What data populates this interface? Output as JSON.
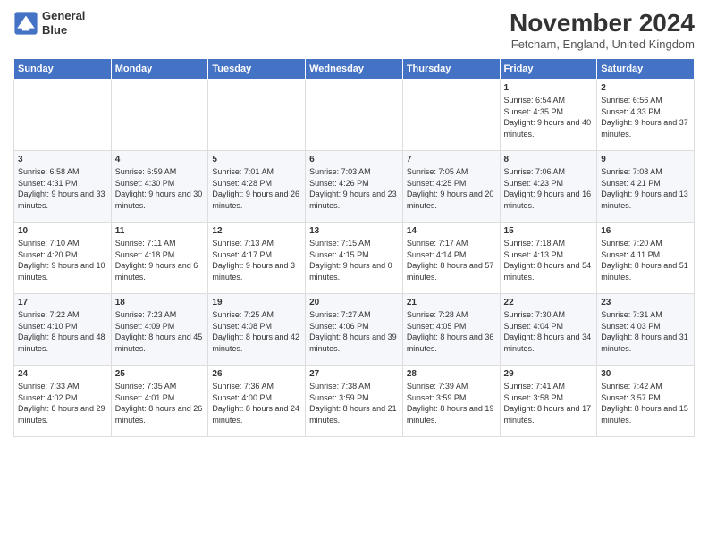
{
  "logo": {
    "line1": "General",
    "line2": "Blue"
  },
  "title": "November 2024",
  "subtitle": "Fetcham, England, United Kingdom",
  "days_of_week": [
    "Sunday",
    "Monday",
    "Tuesday",
    "Wednesday",
    "Thursday",
    "Friday",
    "Saturday"
  ],
  "weeks": [
    [
      {
        "day": "",
        "info": ""
      },
      {
        "day": "",
        "info": ""
      },
      {
        "day": "",
        "info": ""
      },
      {
        "day": "",
        "info": ""
      },
      {
        "day": "",
        "info": ""
      },
      {
        "day": "1",
        "info": "Sunrise: 6:54 AM\nSunset: 4:35 PM\nDaylight: 9 hours and 40 minutes."
      },
      {
        "day": "2",
        "info": "Sunrise: 6:56 AM\nSunset: 4:33 PM\nDaylight: 9 hours and 37 minutes."
      }
    ],
    [
      {
        "day": "3",
        "info": "Sunrise: 6:58 AM\nSunset: 4:31 PM\nDaylight: 9 hours and 33 minutes."
      },
      {
        "day": "4",
        "info": "Sunrise: 6:59 AM\nSunset: 4:30 PM\nDaylight: 9 hours and 30 minutes."
      },
      {
        "day": "5",
        "info": "Sunrise: 7:01 AM\nSunset: 4:28 PM\nDaylight: 9 hours and 26 minutes."
      },
      {
        "day": "6",
        "info": "Sunrise: 7:03 AM\nSunset: 4:26 PM\nDaylight: 9 hours and 23 minutes."
      },
      {
        "day": "7",
        "info": "Sunrise: 7:05 AM\nSunset: 4:25 PM\nDaylight: 9 hours and 20 minutes."
      },
      {
        "day": "8",
        "info": "Sunrise: 7:06 AM\nSunset: 4:23 PM\nDaylight: 9 hours and 16 minutes."
      },
      {
        "day": "9",
        "info": "Sunrise: 7:08 AM\nSunset: 4:21 PM\nDaylight: 9 hours and 13 minutes."
      }
    ],
    [
      {
        "day": "10",
        "info": "Sunrise: 7:10 AM\nSunset: 4:20 PM\nDaylight: 9 hours and 10 minutes."
      },
      {
        "day": "11",
        "info": "Sunrise: 7:11 AM\nSunset: 4:18 PM\nDaylight: 9 hours and 6 minutes."
      },
      {
        "day": "12",
        "info": "Sunrise: 7:13 AM\nSunset: 4:17 PM\nDaylight: 9 hours and 3 minutes."
      },
      {
        "day": "13",
        "info": "Sunrise: 7:15 AM\nSunset: 4:15 PM\nDaylight: 9 hours and 0 minutes."
      },
      {
        "day": "14",
        "info": "Sunrise: 7:17 AM\nSunset: 4:14 PM\nDaylight: 8 hours and 57 minutes."
      },
      {
        "day": "15",
        "info": "Sunrise: 7:18 AM\nSunset: 4:13 PM\nDaylight: 8 hours and 54 minutes."
      },
      {
        "day": "16",
        "info": "Sunrise: 7:20 AM\nSunset: 4:11 PM\nDaylight: 8 hours and 51 minutes."
      }
    ],
    [
      {
        "day": "17",
        "info": "Sunrise: 7:22 AM\nSunset: 4:10 PM\nDaylight: 8 hours and 48 minutes."
      },
      {
        "day": "18",
        "info": "Sunrise: 7:23 AM\nSunset: 4:09 PM\nDaylight: 8 hours and 45 minutes."
      },
      {
        "day": "19",
        "info": "Sunrise: 7:25 AM\nSunset: 4:08 PM\nDaylight: 8 hours and 42 minutes."
      },
      {
        "day": "20",
        "info": "Sunrise: 7:27 AM\nSunset: 4:06 PM\nDaylight: 8 hours and 39 minutes."
      },
      {
        "day": "21",
        "info": "Sunrise: 7:28 AM\nSunset: 4:05 PM\nDaylight: 8 hours and 36 minutes."
      },
      {
        "day": "22",
        "info": "Sunrise: 7:30 AM\nSunset: 4:04 PM\nDaylight: 8 hours and 34 minutes."
      },
      {
        "day": "23",
        "info": "Sunrise: 7:31 AM\nSunset: 4:03 PM\nDaylight: 8 hours and 31 minutes."
      }
    ],
    [
      {
        "day": "24",
        "info": "Sunrise: 7:33 AM\nSunset: 4:02 PM\nDaylight: 8 hours and 29 minutes."
      },
      {
        "day": "25",
        "info": "Sunrise: 7:35 AM\nSunset: 4:01 PM\nDaylight: 8 hours and 26 minutes."
      },
      {
        "day": "26",
        "info": "Sunrise: 7:36 AM\nSunset: 4:00 PM\nDaylight: 8 hours and 24 minutes."
      },
      {
        "day": "27",
        "info": "Sunrise: 7:38 AM\nSunset: 3:59 PM\nDaylight: 8 hours and 21 minutes."
      },
      {
        "day": "28",
        "info": "Sunrise: 7:39 AM\nSunset: 3:59 PM\nDaylight: 8 hours and 19 minutes."
      },
      {
        "day": "29",
        "info": "Sunrise: 7:41 AM\nSunset: 3:58 PM\nDaylight: 8 hours and 17 minutes."
      },
      {
        "day": "30",
        "info": "Sunrise: 7:42 AM\nSunset: 3:57 PM\nDaylight: 8 hours and 15 minutes."
      }
    ]
  ],
  "colors": {
    "header_bg": "#4472C4",
    "header_text": "#ffffff",
    "row_even": "#f5f7fb",
    "row_odd": "#ffffff"
  }
}
